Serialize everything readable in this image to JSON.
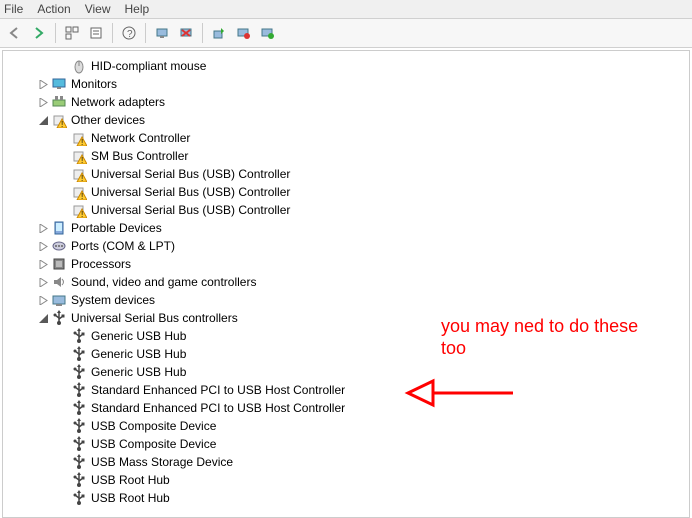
{
  "menu": {
    "file": "File",
    "action": "Action",
    "view": "View",
    "help": "Help"
  },
  "toolbar_icons": {
    "back": "back-arrow",
    "forward": "forward-arrow",
    "up": "up-node",
    "props": "properties",
    "refresh": "refresh",
    "remove": "remove",
    "enable": "enable",
    "scan": "scan-hw"
  },
  "tree": [
    {
      "depth": 2,
      "expand": "",
      "icon": "mouse",
      "label": "HID-compliant mouse"
    },
    {
      "depth": 1,
      "expand": "▷",
      "icon": "monitor",
      "label": "Monitors"
    },
    {
      "depth": 1,
      "expand": "▷",
      "icon": "network",
      "label": "Network adapters"
    },
    {
      "depth": 1,
      "expand": "◢",
      "icon": "other-warn",
      "label": "Other devices"
    },
    {
      "depth": 2,
      "expand": "",
      "icon": "other-warn",
      "label": "Network Controller"
    },
    {
      "depth": 2,
      "expand": "",
      "icon": "other-warn",
      "label": "SM Bus Controller"
    },
    {
      "depth": 2,
      "expand": "",
      "icon": "other-warn",
      "label": "Universal Serial Bus (USB) Controller"
    },
    {
      "depth": 2,
      "expand": "",
      "icon": "other-warn",
      "label": "Universal Serial Bus (USB) Controller"
    },
    {
      "depth": 2,
      "expand": "",
      "icon": "other-warn",
      "label": "Universal Serial Bus (USB) Controller"
    },
    {
      "depth": 1,
      "expand": "▷",
      "icon": "portable",
      "label": "Portable Devices"
    },
    {
      "depth": 1,
      "expand": "▷",
      "icon": "ports",
      "label": "Ports (COM & LPT)"
    },
    {
      "depth": 1,
      "expand": "▷",
      "icon": "cpu",
      "label": "Processors"
    },
    {
      "depth": 1,
      "expand": "▷",
      "icon": "sound",
      "label": "Sound, video and game controllers"
    },
    {
      "depth": 1,
      "expand": "▷",
      "icon": "system",
      "label": "System devices"
    },
    {
      "depth": 1,
      "expand": "◢",
      "icon": "usb",
      "label": "Universal Serial Bus controllers"
    },
    {
      "depth": 2,
      "expand": "",
      "icon": "usb",
      "label": "Generic USB Hub"
    },
    {
      "depth": 2,
      "expand": "",
      "icon": "usb",
      "label": "Generic USB Hub"
    },
    {
      "depth": 2,
      "expand": "",
      "icon": "usb",
      "label": "Generic USB Hub"
    },
    {
      "depth": 2,
      "expand": "",
      "icon": "usb",
      "label": "Standard Enhanced PCI to USB Host Controller"
    },
    {
      "depth": 2,
      "expand": "",
      "icon": "usb",
      "label": "Standard Enhanced PCI to USB Host Controller"
    },
    {
      "depth": 2,
      "expand": "",
      "icon": "usb",
      "label": "USB Composite Device"
    },
    {
      "depth": 2,
      "expand": "",
      "icon": "usb",
      "label": "USB Composite Device"
    },
    {
      "depth": 2,
      "expand": "",
      "icon": "usb",
      "label": "USB Mass Storage Device"
    },
    {
      "depth": 2,
      "expand": "",
      "icon": "usb",
      "label": "USB Root Hub"
    },
    {
      "depth": 2,
      "expand": "",
      "icon": "usb",
      "label": "USB Root Hub"
    }
  ],
  "annotation": {
    "text_line1": "you may ned to do these",
    "text_line2": "too"
  }
}
